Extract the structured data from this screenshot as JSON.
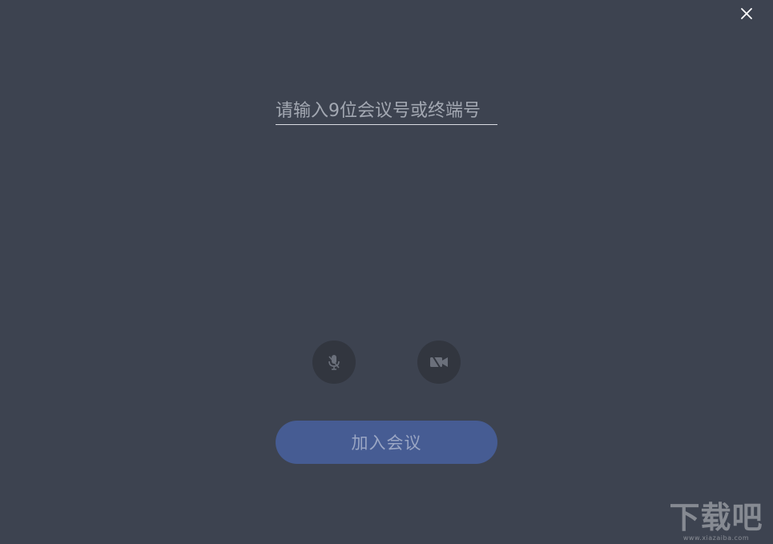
{
  "window": {
    "close_icon": "close-icon"
  },
  "meeting_input": {
    "value": "",
    "placeholder": "请输入9位会议号或终端号"
  },
  "controls": {
    "mic_icon": "mic-muted-icon",
    "camera_icon": "camera-off-icon"
  },
  "join_button": {
    "label": "加入会议"
  },
  "watermark": {
    "text": "下载吧",
    "url_text": "www.xiazaiba.com"
  },
  "colors": {
    "background": "#3d4350",
    "round_button": "#32363f",
    "join_button": "#465c93"
  }
}
